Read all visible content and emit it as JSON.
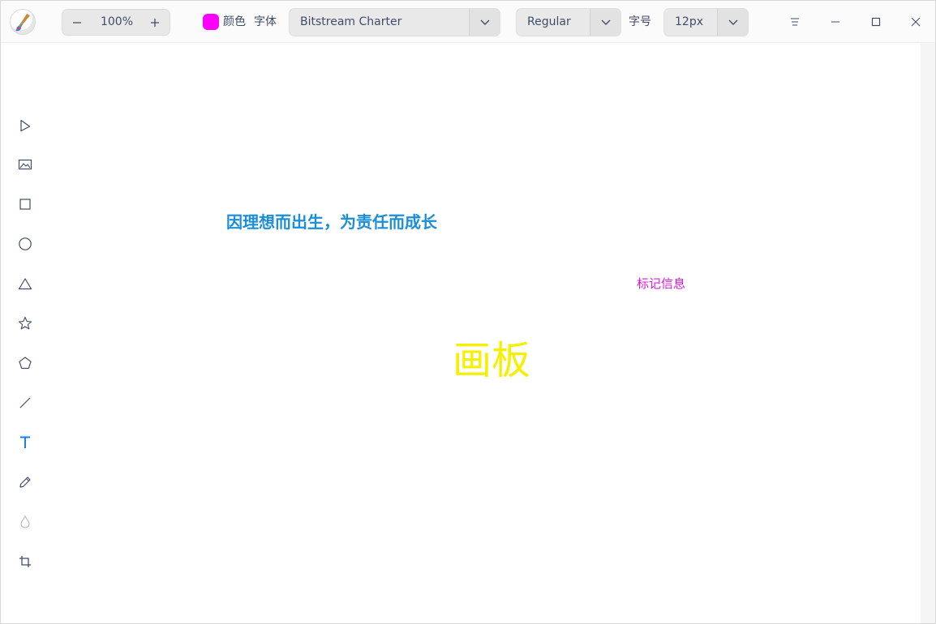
{
  "toolbar_top": {
    "zoom": "100%",
    "color_label": "颜色",
    "font_label": "字体",
    "font_family": "Bitstream Charter",
    "font_weight": "Regular",
    "size_label": "字号",
    "font_size": "12px"
  },
  "colors": {
    "swatch": "#ff00ff",
    "active_tool": "#1a7fe8",
    "icon": "#414d68"
  },
  "tools": [
    {
      "name": "select-tool",
      "icon": "cursor-arrow-icon"
    },
    {
      "name": "image-tool",
      "icon": "image-icon"
    },
    {
      "name": "rectangle-tool",
      "icon": "square-icon"
    },
    {
      "name": "ellipse-tool",
      "icon": "circle-icon"
    },
    {
      "name": "triangle-tool",
      "icon": "triangle-icon"
    },
    {
      "name": "star-tool",
      "icon": "star-icon"
    },
    {
      "name": "polygon-tool",
      "icon": "pentagon-icon"
    },
    {
      "name": "line-tool",
      "icon": "line-icon"
    },
    {
      "name": "text-tool",
      "icon": "text-icon",
      "active": true
    },
    {
      "name": "pencil-tool",
      "icon": "pencil-icon"
    },
    {
      "name": "blur-tool",
      "icon": "drop-icon"
    },
    {
      "name": "crop-tool",
      "icon": "crop-icon"
    }
  ],
  "canvas": {
    "slogan": "因理想而出生，为责任而成长",
    "mark": "标记信息",
    "board": "画板"
  }
}
